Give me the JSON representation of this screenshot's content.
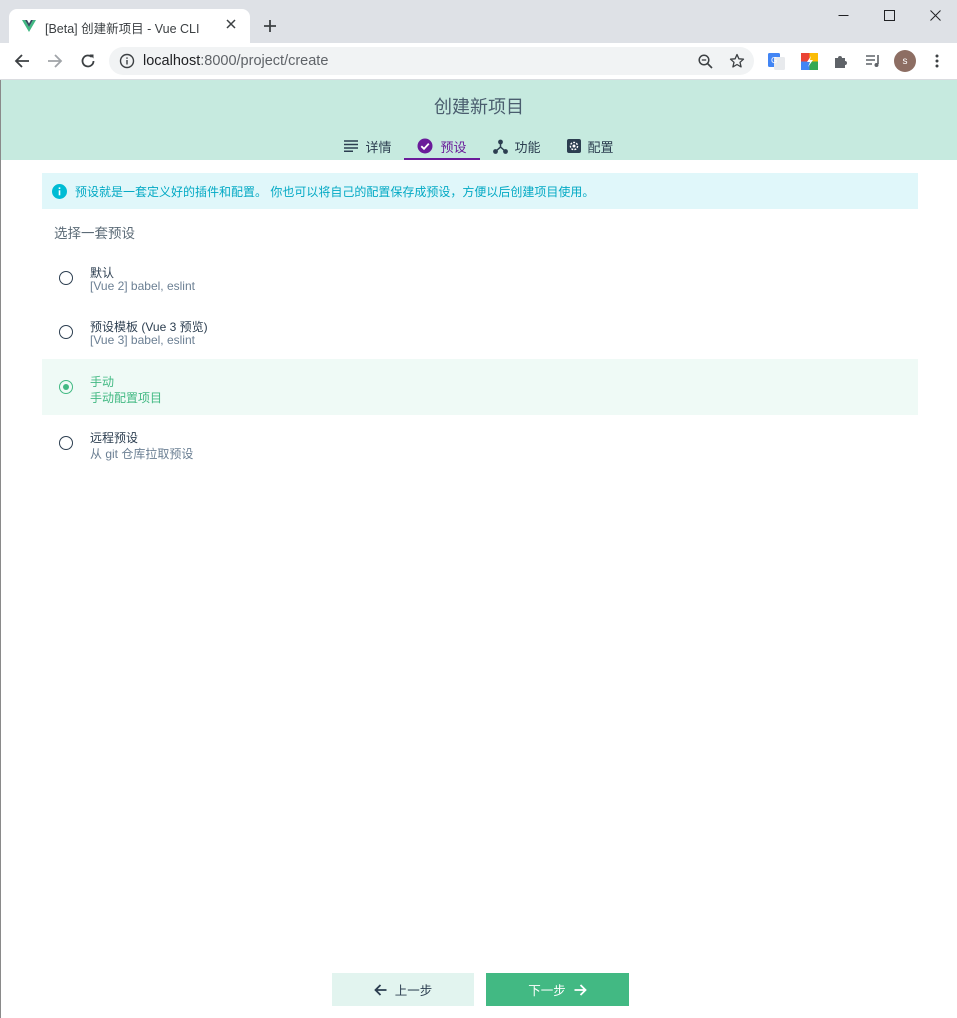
{
  "browser": {
    "tab_title": "[Beta] 创建新项目 - Vue CLI",
    "url_host": "localhost",
    "url_rest": ":8000/project/create",
    "avatar_letter": "s"
  },
  "app": {
    "title": "创建新项目",
    "tabs": [
      {
        "label": "详情",
        "icon": "list-icon",
        "active": false
      },
      {
        "label": "预设",
        "icon": "check-circle-icon",
        "active": true
      },
      {
        "label": "功能",
        "icon": "tree-icon",
        "active": false
      },
      {
        "label": "配置",
        "icon": "settings-icon",
        "active": false
      }
    ],
    "info_text": "预设就是一套定义好的插件和配置。 你也可以将自己的配置保存成预设，方便以后创建项目使用。",
    "section_label": "选择一套预设",
    "presets": [
      {
        "name": "默认",
        "desc": "[Vue 2] babel, eslint",
        "selected": false
      },
      {
        "name": "预设模板 (Vue 3 预览)",
        "desc": "[Vue 3] babel, eslint",
        "selected": false
      },
      {
        "name": "手动",
        "desc": "手动配置项目",
        "selected": true
      },
      {
        "name": "远程预设",
        "desc": "从 git 仓库拉取预设",
        "selected": false
      }
    ],
    "prev_label": "上一步",
    "next_label": "下一步"
  },
  "colors": {
    "header_bg": "#c6eadf",
    "accent_green": "#42b983",
    "active_tab": "#6a1b9a",
    "info_bg": "#e0f7fa",
    "info_text": "#03a9c4"
  }
}
